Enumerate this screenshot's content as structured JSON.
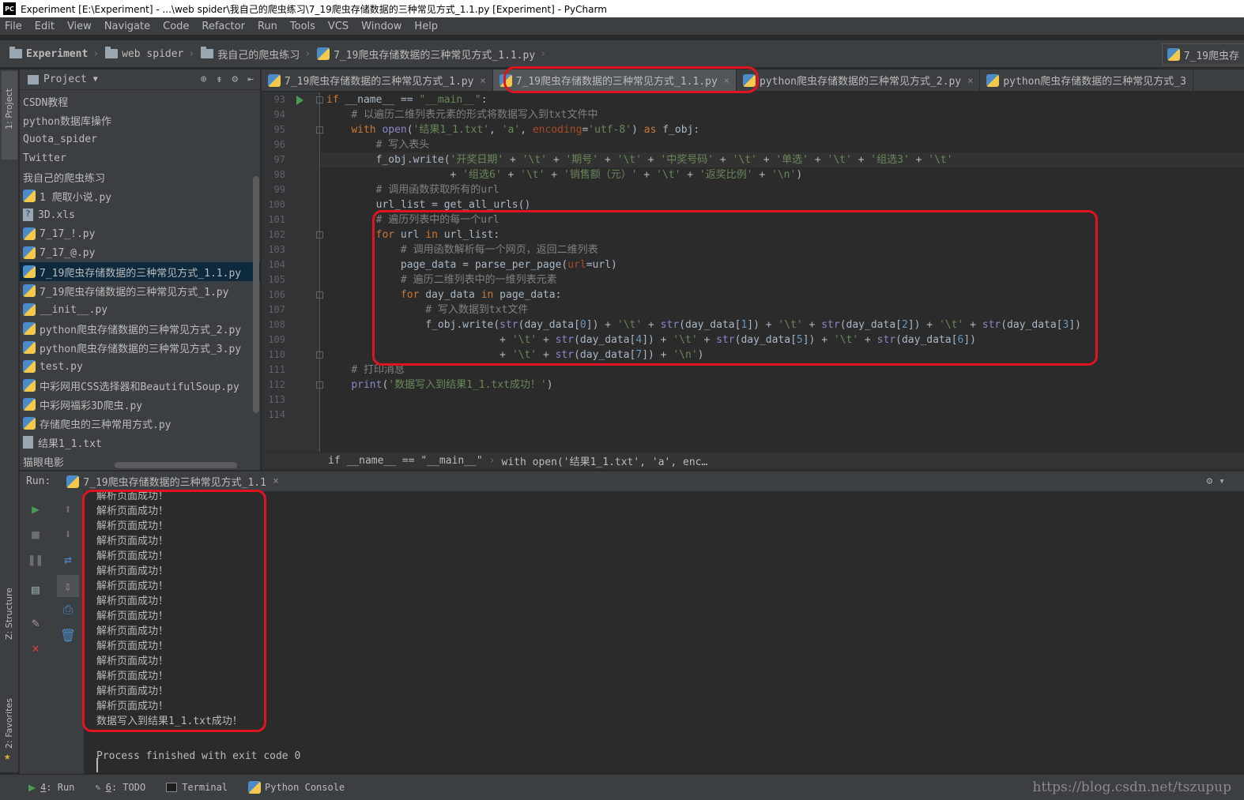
{
  "window": {
    "title": "Experiment [E:\\Experiment] - ...\\web spider\\我自己的爬虫练习\\7_19爬虫存储数据的三种常见方式_1.1.py [Experiment] - PyCharm",
    "app_icon_text": "PC"
  },
  "menu": [
    "File",
    "Edit",
    "View",
    "Navigate",
    "Code",
    "Refactor",
    "Run",
    "Tools",
    "VCS",
    "Window",
    "Help"
  ],
  "breadcrumb": [
    "Experiment",
    "web spider",
    "我自己的爬虫练习",
    "7_19爬虫存储数据的三种常见方式_1.1.py"
  ],
  "nav_right_tab": "7_19爬虫存",
  "left_tool": {
    "project": "1: Project",
    "structure": "Z: Structure",
    "favorites": "2: Favorites"
  },
  "project": {
    "header": "Project",
    "items": [
      {
        "label": "CSDN教程",
        "icon": "none"
      },
      {
        "label": "python数据库操作",
        "icon": "none"
      },
      {
        "label": "Quota_spider",
        "icon": "none"
      },
      {
        "label": "Twitter",
        "icon": "none"
      },
      {
        "label": "我自己的爬虫练习",
        "icon": "none"
      },
      {
        "label": "1 爬取小说.py",
        "icon": "py"
      },
      {
        "label": "3D.xls",
        "icon": "xls"
      },
      {
        "label": "7_17_!.py",
        "icon": "py"
      },
      {
        "label": "7_17_@.py",
        "icon": "py"
      },
      {
        "label": "7_19爬虫存储数据的三种常见方式_1.1.py",
        "icon": "py",
        "selected": true
      },
      {
        "label": "7_19爬虫存储数据的三种常见方式_1.py",
        "icon": "py"
      },
      {
        "label": "__init__.py",
        "icon": "py"
      },
      {
        "label": "python爬虫存储数据的三种常见方式_2.py",
        "icon": "py"
      },
      {
        "label": "python爬虫存储数据的三种常见方式_3.py",
        "icon": "py"
      },
      {
        "label": "test.py",
        "icon": "py"
      },
      {
        "label": "中彩网用CSS选择器和BeautifulSoup.py",
        "icon": "py"
      },
      {
        "label": "中彩网福彩3D爬虫.py",
        "icon": "py"
      },
      {
        "label": "存储爬虫的三种常用方式.py",
        "icon": "py"
      },
      {
        "label": "结果1_1.txt",
        "icon": "txt"
      },
      {
        "label": "猫眼电影",
        "icon": "none"
      }
    ]
  },
  "tabs": [
    {
      "label": "7_19爬虫存储数据的三种常见方式_1.py"
    },
    {
      "label": "7_19爬虫存储数据的三种常见方式_1.1.py",
      "active": true
    },
    {
      "label": "python爬虫存储数据的三种常见方式_2.py"
    },
    {
      "label": "python爬虫存储数据的三种常见方式_3"
    }
  ],
  "editor": {
    "line_numbers": [
      "93",
      "94",
      "95",
      "96",
      "97",
      "98",
      "99",
      "100",
      "101",
      "102",
      "103",
      "104",
      "105",
      "106",
      "107",
      "108",
      "109",
      "110",
      "111",
      "112",
      "113",
      "114"
    ],
    "breadcrumb": [
      "if __name__ == \"__main__\"",
      "with open('结果1_1.txt', 'a', enc…"
    ]
  },
  "run": {
    "label": "Run:",
    "tab": "7_19爬虫存储数据的三种常见方式_1.1",
    "output": [
      "解析页面成功！",
      "解析页面成功！",
      "解析页面成功！",
      "解析页面成功！",
      "解析页面成功！",
      "解析页面成功！",
      "解析页面成功！",
      "解析页面成功！",
      "解析页面成功！",
      "解析页面成功！",
      "解析页面成功！",
      "解析页面成功！",
      "解析页面成功！",
      "解析页面成功！",
      "解析页面成功！",
      "数据写入到结果1_1.txt成功！"
    ],
    "exit": "Process finished with exit code 0"
  },
  "statusbar": [
    {
      "num": "4",
      "label": ": Run"
    },
    {
      "num": "6",
      "label": ": TODO"
    },
    {
      "num": "",
      "label": "Terminal"
    },
    {
      "num": "",
      "label": "Python Console"
    }
  ],
  "watermark": "https://blog.csdn.net/tszupup",
  "colors": {
    "keyword": "#cc7832",
    "string": "#6a8759",
    "comment": "#808080",
    "number": "#6897bb",
    "builtin": "#8888c6",
    "param": "#aa4926",
    "highlight": "#e0141e"
  }
}
